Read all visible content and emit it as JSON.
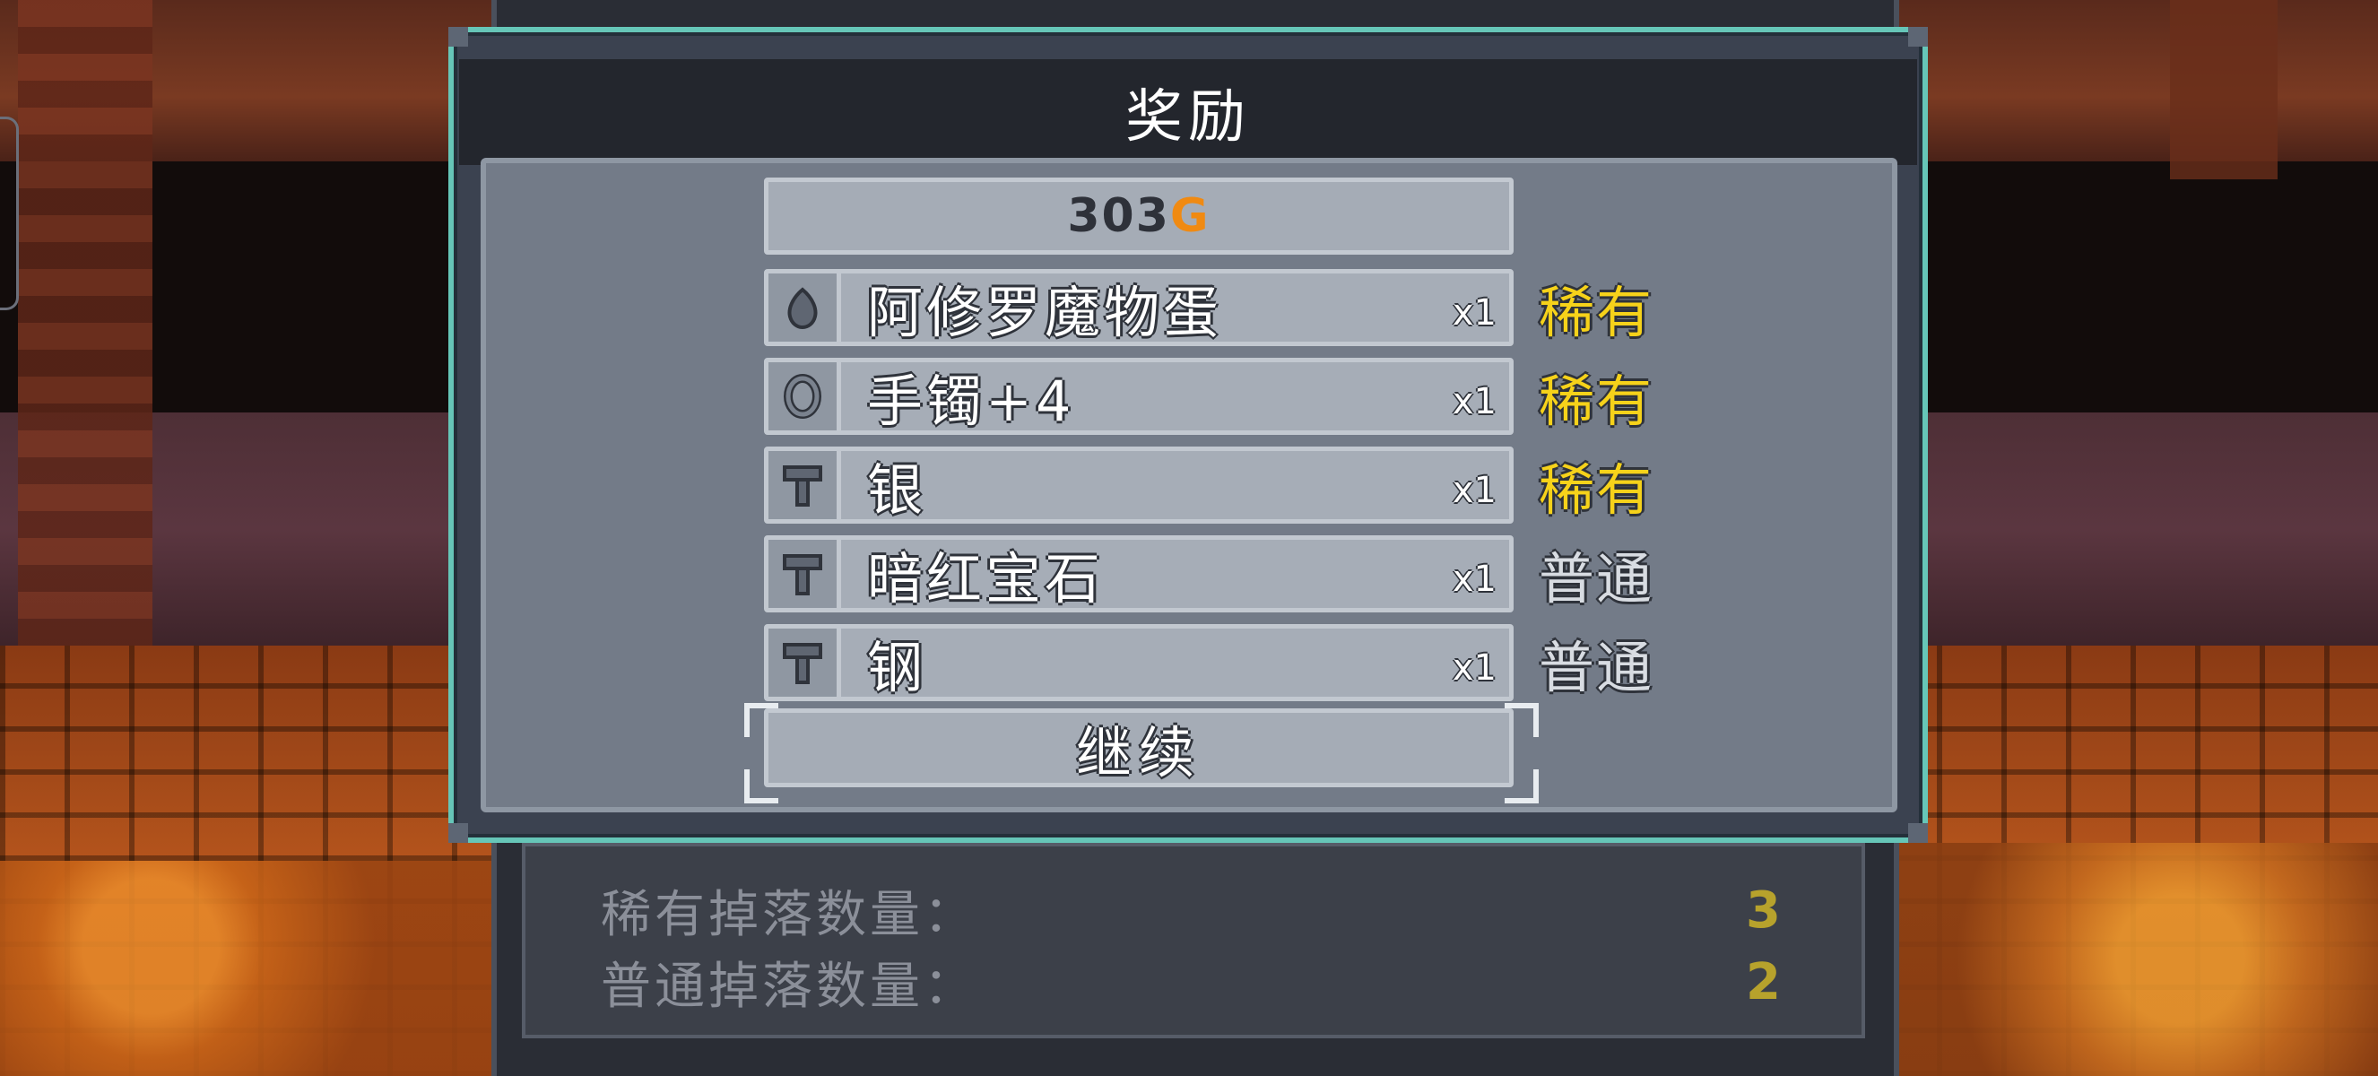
{
  "dialog": {
    "title": "奖励"
  },
  "gold": {
    "amount": "303",
    "suffix": "G"
  },
  "items": [
    {
      "name": "阿修罗魔物蛋",
      "qty": "x1",
      "rarity": "稀有",
      "rarity_color": "#f6d21a",
      "icon": "egg-icon"
    },
    {
      "name": "手镯+4",
      "qty": "x1",
      "rarity": "稀有",
      "rarity_color": "#f6d21a",
      "icon": "bracelet-icon"
    },
    {
      "name": "银",
      "qty": "x1",
      "rarity": "稀有",
      "rarity_color": "#f6d21a",
      "icon": "hammer-icon"
    },
    {
      "name": "暗红宝石",
      "qty": "x1",
      "rarity": "普通",
      "rarity_color": "#d8dce2",
      "icon": "hammer-icon"
    },
    {
      "name": "钢",
      "qty": "x1",
      "rarity": "普通",
      "rarity_color": "#d8dce2",
      "icon": "hammer-icon"
    }
  ],
  "continue_label": "继续",
  "summary": [
    {
      "label": "稀有掉落数量：",
      "value": "3"
    },
    {
      "label": "普通掉落数量：",
      "value": "2"
    }
  ],
  "colors": {
    "accent": "#66c6b8",
    "gold": "#f08a12",
    "rare": "#f6d21a"
  }
}
